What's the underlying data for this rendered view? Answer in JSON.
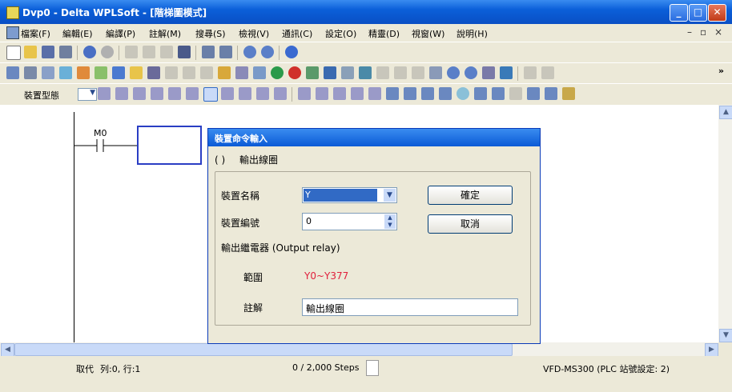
{
  "window": {
    "title": "Dvp0 - Delta WPLSoft - [階梯圖模式]"
  },
  "menu": [
    "檔案(F)",
    "編輯(E)",
    "編譯(P)",
    "註解(M)",
    "搜尋(S)",
    "檢視(V)",
    "通訊(C)",
    "設定(O)",
    "精靈(D)",
    "視窗(W)",
    "說明(H)"
  ],
  "toolbar": {
    "device_type_label": "裝置型態"
  },
  "ladder": {
    "contact_label": "M0"
  },
  "dialog": {
    "title": "裝置命令輸入",
    "instruction_symbol": "( )",
    "instruction_name": "輸出線圈",
    "device_name_label": "裝置名稱",
    "device_name_value": "Y",
    "device_number_label": "裝置編號",
    "device_number_value": "0",
    "device_description": "輸出繼電器 (Output relay)",
    "range_label": "範圍",
    "range_value": "Y0~Y377",
    "comment_label": "註解",
    "comment_value": "輸出線圈",
    "ok_label": "確定",
    "cancel_label": "取消"
  },
  "status": {
    "mode": "取代",
    "position": "列:0, 行:1",
    "steps": "0 / 2,000 Steps",
    "plc": "VFD-MS300 (PLC 站號設定: 2)"
  },
  "colors": {
    "title_bar": "#0b5fd9",
    "selection": "#316ac5",
    "range_text": "#e0203c",
    "cursor_box": "#2a3ec4"
  }
}
